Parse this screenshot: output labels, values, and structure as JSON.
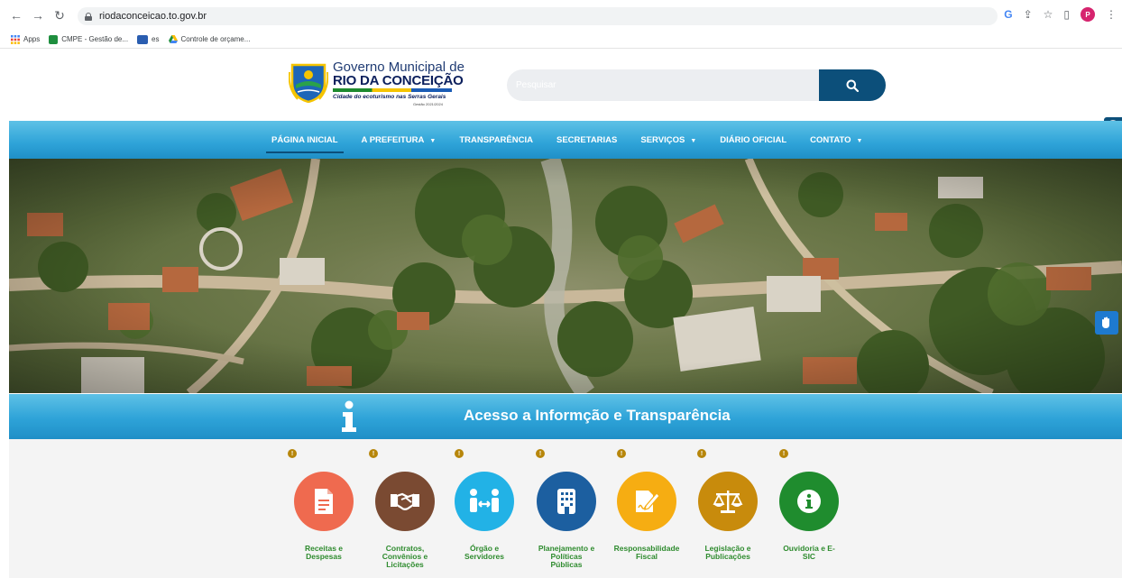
{
  "browser": {
    "url": "riodaconceicao.to.gov.br",
    "profile_initial": "P",
    "bookmarks": [
      {
        "label": "Apps",
        "icon": "apps-grid-icon"
      },
      {
        "label": "CMPE - Gestão de...",
        "icon": "cmpe-icon"
      },
      {
        "label": "es",
        "icon": "sei-icon"
      },
      {
        "label": "Controle de orçame...",
        "icon": "google-drive-icon"
      }
    ]
  },
  "header": {
    "logo": {
      "line1": "Governo Municipal de",
      "line2": "RIO DA CONCEIÇÃO",
      "line3": "Cidade do ecoturismo nas Serras Gerais",
      "line4": "Gestão 2021/2024"
    },
    "search": {
      "placeholder": "Pesquisar"
    }
  },
  "nav": {
    "items": [
      {
        "label": "PÁGINA INICIAL",
        "dropdown": false,
        "active": true
      },
      {
        "label": "A PREFEITURA",
        "dropdown": true,
        "active": false
      },
      {
        "label": "TRANSPARÊNCIA",
        "dropdown": false,
        "active": false
      },
      {
        "label": "SECRETARIAS",
        "dropdown": false,
        "active": false
      },
      {
        "label": "SERVIÇOS",
        "dropdown": true,
        "active": false
      },
      {
        "label": "DIÁRIO OFICIAL",
        "dropdown": false,
        "active": false
      },
      {
        "label": "CONTATO",
        "dropdown": true,
        "active": false
      }
    ]
  },
  "banner": {
    "title": "Acesso a Informção e Transparência"
  },
  "services": [
    {
      "label_lines": [
        "Receitas e",
        "Despesas"
      ],
      "color": "#ef6a4f",
      "icon": "document-icon"
    },
    {
      "label_lines": [
        "Contratos,",
        "Convênios e",
        "Licitações"
      ],
      "color": "#7a4a32",
      "icon": "handshake-icon"
    },
    {
      "label_lines": [
        "Órgão e",
        "Servidores"
      ],
      "color": "#22b2e6",
      "icon": "people-arrows-icon"
    },
    {
      "label_lines": [
        "Planejamento e",
        "Políticas",
        "Públicas"
      ],
      "color": "#1c5fa0",
      "icon": "building-icon"
    },
    {
      "label_lines": [
        "Responsabilidade",
        "Fiscal"
      ],
      "color": "#f6ad12",
      "icon": "signature-icon"
    },
    {
      "label_lines": [
        "Legislação e",
        "Publicações"
      ],
      "color": "#c88b0c",
      "icon": "scales-icon"
    },
    {
      "label_lines": [
        "Ouvidoria e E-",
        "SIC"
      ],
      "color": "#1f8c2e",
      "icon": "info-icon"
    }
  ],
  "colors": {
    "nav_gradient_top": "#5ec1e6",
    "nav_gradient_bottom": "#1f8fc7",
    "dark_blue": "#0c4f7a",
    "label_green": "#2e8b2e",
    "info_badge": "#b7860b"
  }
}
